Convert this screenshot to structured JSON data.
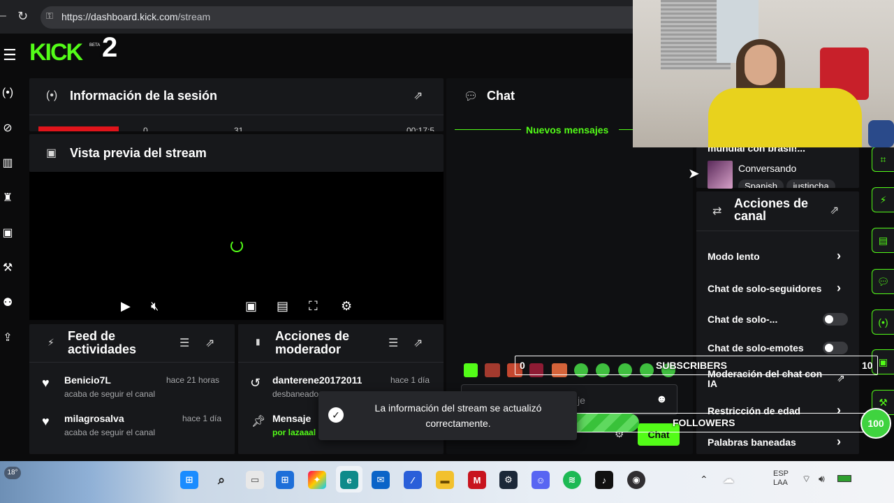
{
  "browser": {
    "url_host": "https://dashboard.kick.com",
    "url_path": "/stream"
  },
  "logo": {
    "text": "KICK",
    "badge": "BETA",
    "overlay_number": "2"
  },
  "session_info": {
    "title": "Información de la sesión",
    "stats_partial": [
      "0",
      "31",
      "00:17:5"
    ]
  },
  "stream_preview": {
    "title": "Vista previa del stream"
  },
  "chat": {
    "title": "Chat",
    "new_messages": "Nuevos mensajes",
    "input_placeholder": "je",
    "send_label": "Chat"
  },
  "stream_card": {
    "title_partial": "mundial con brasil!...",
    "category": "Conversando",
    "tags": [
      "Spanish",
      "justincha"
    ]
  },
  "channel_actions": {
    "title": "Acciones de canal",
    "items": [
      {
        "label": "Modo lento",
        "type": "arrow"
      },
      {
        "label": "Chat de solo-seguidores",
        "type": "arrow"
      },
      {
        "label": "Chat de solo-...",
        "type": "toggle"
      },
      {
        "label": "Chat de solo-emotes",
        "type": "toggle"
      },
      {
        "label": "Moderación del chat con IA",
        "type": "external"
      },
      {
        "label": "Restricción de edad",
        "type": "arrow"
      },
      {
        "label": "Palabras baneadas",
        "type": "arrow"
      }
    ]
  },
  "activity_feed": {
    "title": "Feed de actividades",
    "items": [
      {
        "name": "Benicio7L",
        "action": "acaba de seguir el canal",
        "time": "hace 21 horas"
      },
      {
        "name": "milagrosalva",
        "action": "acaba de seguir el canal",
        "time": "hace 1 día"
      }
    ]
  },
  "mod_actions": {
    "title": "Acciones de moderador",
    "items": [
      {
        "name": "danterene20172011",
        "action": "desbaneado",
        "time": "hace 1 día"
      },
      {
        "name": "Mensaje",
        "action": "por lazaaal",
        "time": ""
      }
    ]
  },
  "toast": {
    "message": "La información del stream se actualizó correctamente."
  },
  "overlays": {
    "subscribers": {
      "label": "SUBSCRIBERS",
      "current": "0",
      "goal": "10"
    },
    "followers": {
      "label": "FOLLOWERS",
      "current": "31",
      "goal": "100",
      "progress": 0.31
    }
  },
  "taskbar": {
    "weather": "18°",
    "lang_line1": "ESP",
    "lang_line2": "LAA"
  },
  "colors": {
    "accent": "#53fc18",
    "panel": "#17181b",
    "bg": "#0b0b0c"
  }
}
